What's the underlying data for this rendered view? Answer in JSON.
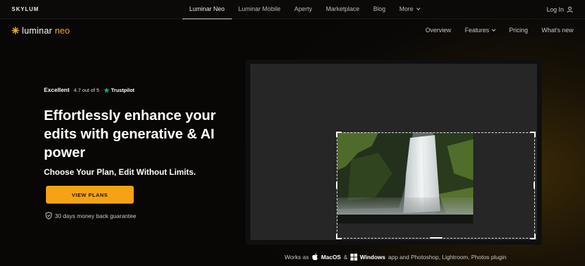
{
  "topbar": {
    "brand": "SKYLUM",
    "nav": [
      "Luminar Neo",
      "Luminar Mobile",
      "Aperty",
      "Marketplace",
      "Blog",
      "More"
    ],
    "login": "Log In"
  },
  "subbar": {
    "logo_word1": "luminar",
    "logo_word2": "neo",
    "nav": [
      "Overview",
      "Features",
      "Pricing",
      "What's new"
    ]
  },
  "hero": {
    "rating_label": "Excellent",
    "rating_score": "4.7 out of 5",
    "trustpilot": "Trustpilot",
    "headline": "Effortlessly enhance your edits with generative & AI power",
    "subhead": "Choose Your Plan, Edit Without Limits.",
    "cta": "VIEW PLANS",
    "guarantee": "30 days money back guarantee"
  },
  "footnote": {
    "prefix": "Works as",
    "macos": "MacOS",
    "amp": "&",
    "windows": "Windows",
    "suffix": "app and Photoshop, Lightroom, Photos plugin"
  },
  "colors": {
    "accent": "#f5a214",
    "trustpilot_green": "#00b67a"
  },
  "icons": [
    "user-icon",
    "chevron-down-icon",
    "sun-logo-icon",
    "star-icon",
    "shield-check-icon",
    "apple-icon",
    "windows-icon"
  ]
}
